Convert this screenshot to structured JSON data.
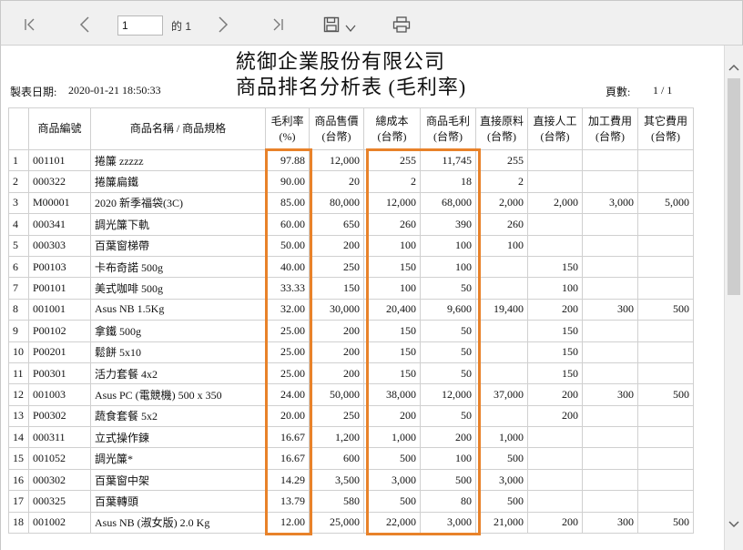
{
  "toolbar": {
    "page_value": "1",
    "page_of": "的 1",
    "icons": [
      "first-page-icon",
      "prev-page-icon",
      "next-page-icon",
      "last-page-icon",
      "save-icon",
      "dropdown-chevron-icon",
      "print-icon"
    ]
  },
  "report": {
    "company": "統御企業股份有限公司",
    "title": "商品排名分析表 (毛利率)",
    "date_label": "製表日期:",
    "date_value": "2020-01-21 18:50:33",
    "page_label": "頁數:",
    "page_value": "1 / 1",
    "headers": [
      "",
      "商品編號",
      "商品名稱 / 商品規格",
      "毛利率 (%)",
      "商品售價 (台幣)",
      "總成本 (台幣)",
      "商品毛利 (台幣)",
      "直接原料 (台幣)",
      "直接人工 (台幣)",
      "加工費用 (台幣)",
      "其它費用 (台幣)"
    ],
    "rows": [
      [
        "1",
        "001101",
        "捲簾 zzzzz",
        "97.88",
        "12,000",
        "255",
        "11,745",
        "255",
        "",
        "",
        ""
      ],
      [
        "2",
        "000322",
        "捲簾扁鐵",
        "90.00",
        "20",
        "2",
        "18",
        "2",
        "",
        "",
        ""
      ],
      [
        "3",
        "M00001",
        "2020 新季福袋(3C)",
        "85.00",
        "80,000",
        "12,000",
        "68,000",
        "2,000",
        "2,000",
        "3,000",
        "5,000"
      ],
      [
        "4",
        "000341",
        "調光簾下軌",
        "60.00",
        "650",
        "260",
        "390",
        "260",
        "",
        "",
        ""
      ],
      [
        "5",
        "000303",
        "百葉窗梯帶",
        "50.00",
        "200",
        "100",
        "100",
        "100",
        "",
        "",
        ""
      ],
      [
        "6",
        "P00103",
        "卡布奇諾 500g",
        "40.00",
        "250",
        "150",
        "100",
        "",
        "150",
        "",
        ""
      ],
      [
        "7",
        "P00101",
        "美式咖啡 500g",
        "33.33",
        "150",
        "100",
        "50",
        "",
        "100",
        "",
        ""
      ],
      [
        "8",
        "001001",
        "Asus NB 1.5Kg",
        "32.00",
        "30,000",
        "20,400",
        "9,600",
        "19,400",
        "200",
        "300",
        "500"
      ],
      [
        "9",
        "P00102",
        "拿鐵 500g",
        "25.00",
        "200",
        "150",
        "50",
        "",
        "150",
        "",
        ""
      ],
      [
        "10",
        "P00201",
        "鬆餅 5x10",
        "25.00",
        "200",
        "150",
        "50",
        "",
        "150",
        "",
        ""
      ],
      [
        "11",
        "P00301",
        "活力套餐 4x2",
        "25.00",
        "200",
        "150",
        "50",
        "",
        "150",
        "",
        ""
      ],
      [
        "12",
        "001003",
        "Asus PC (電競機) 500 x 350",
        "24.00",
        "50,000",
        "38,000",
        "12,000",
        "37,000",
        "200",
        "300",
        "500"
      ],
      [
        "13",
        "P00302",
        "蔬食套餐 5x2",
        "20.00",
        "250",
        "200",
        "50",
        "",
        "200",
        "",
        ""
      ],
      [
        "14",
        "000311",
        "立式操作鍊",
        "16.67",
        "1,200",
        "1,000",
        "200",
        "1,000",
        "",
        "",
        ""
      ],
      [
        "15",
        "001052",
        "調光簾*",
        "16.67",
        "600",
        "500",
        "100",
        "500",
        "",
        "",
        ""
      ],
      [
        "16",
        "000302",
        "百葉窗中架",
        "14.29",
        "3,500",
        "3,000",
        "500",
        "3,000",
        "",
        "",
        ""
      ],
      [
        "17",
        "000325",
        "百葉轉頭",
        "13.79",
        "580",
        "500",
        "80",
        "500",
        "",
        "",
        ""
      ],
      [
        "18",
        "001002",
        "Asus NB (淑女版) 2.0 Kg",
        "12.00",
        "25,000",
        "22,000",
        "3,000",
        "21,000",
        "200",
        "300",
        "500"
      ]
    ]
  },
  "colors": {
    "highlight": "#e8822a",
    "toolbar_bg": "#f0f0f0",
    "grid_border": "#d0d0d0"
  }
}
